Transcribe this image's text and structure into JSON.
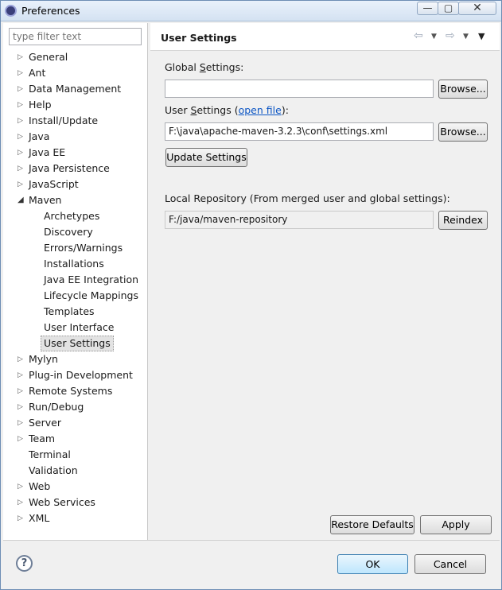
{
  "window": {
    "title": "Preferences",
    "min_glyph": "—",
    "max_glyph": "▢",
    "close_glyph": "✕"
  },
  "sidebar": {
    "filter_placeholder": "type filter text",
    "items": [
      {
        "label": "General",
        "expandable": true,
        "expanded": false,
        "level": 0
      },
      {
        "label": "Ant",
        "expandable": true,
        "expanded": false,
        "level": 0
      },
      {
        "label": "Data Management",
        "expandable": true,
        "expanded": false,
        "level": 0
      },
      {
        "label": "Help",
        "expandable": true,
        "expanded": false,
        "level": 0
      },
      {
        "label": "Install/Update",
        "expandable": true,
        "expanded": false,
        "level": 0
      },
      {
        "label": "Java",
        "expandable": true,
        "expanded": false,
        "level": 0
      },
      {
        "label": "Java EE",
        "expandable": true,
        "expanded": false,
        "level": 0
      },
      {
        "label": "Java Persistence",
        "expandable": true,
        "expanded": false,
        "level": 0
      },
      {
        "label": "JavaScript",
        "expandable": true,
        "expanded": false,
        "level": 0
      },
      {
        "label": "Maven",
        "expandable": true,
        "expanded": true,
        "level": 0
      },
      {
        "label": "Archetypes",
        "expandable": false,
        "level": 1
      },
      {
        "label": "Discovery",
        "expandable": false,
        "level": 1
      },
      {
        "label": "Errors/Warnings",
        "expandable": false,
        "level": 1
      },
      {
        "label": "Installations",
        "expandable": false,
        "level": 1
      },
      {
        "label": "Java EE Integration",
        "expandable": false,
        "level": 1
      },
      {
        "label": "Lifecycle Mappings",
        "expandable": false,
        "level": 1
      },
      {
        "label": "Templates",
        "expandable": false,
        "level": 1
      },
      {
        "label": "User Interface",
        "expandable": false,
        "level": 1
      },
      {
        "label": "User Settings",
        "expandable": false,
        "level": 1,
        "selected": true
      },
      {
        "label": "Mylyn",
        "expandable": true,
        "expanded": false,
        "level": 0
      },
      {
        "label": "Plug-in Development",
        "expandable": true,
        "expanded": false,
        "level": 0
      },
      {
        "label": "Remote Systems",
        "expandable": true,
        "expanded": false,
        "level": 0
      },
      {
        "label": "Run/Debug",
        "expandable": true,
        "expanded": false,
        "level": 0
      },
      {
        "label": "Server",
        "expandable": true,
        "expanded": false,
        "level": 0
      },
      {
        "label": "Team",
        "expandable": true,
        "expanded": false,
        "level": 0
      },
      {
        "label": "Terminal",
        "expandable": false,
        "level": 0
      },
      {
        "label": "Validation",
        "expandable": false,
        "level": 0
      },
      {
        "label": "Web",
        "expandable": true,
        "expanded": false,
        "level": 0
      },
      {
        "label": "Web Services",
        "expandable": true,
        "expanded": false,
        "level": 0
      },
      {
        "label": "XML",
        "expandable": true,
        "expanded": false,
        "level": 0
      }
    ]
  },
  "page": {
    "title": "User Settings",
    "nav": {
      "back_glyph": "⇦",
      "forward_glyph": "⇨",
      "dropdown_glyph": "▼",
      "view_menu_glyph": "▼"
    },
    "global_settings": {
      "label_before": "Global ",
      "label_mnemonic": "S",
      "label_after": "ettings:",
      "value": "",
      "browse_label": "Browse..."
    },
    "user_settings": {
      "label_before": "User ",
      "label_mnemonic": "S",
      "label_after": "ettings (",
      "link_label": "open file",
      "label_close": "):",
      "value": "F:\\java\\apache-maven-3.2.3\\conf\\settings.xml",
      "browse_label": "Browse..."
    },
    "update_settings_label": "Update Settings",
    "local_repository": {
      "label": "Local Repository (From merged user and global settings):",
      "value": "F:/java/maven-repository",
      "reindex_label": "Reindex"
    },
    "restore_defaults_label": "Restore Defaults",
    "apply_label": "Apply"
  },
  "footer": {
    "help_glyph": "?",
    "ok_label": "OK",
    "cancel_label": "Cancel"
  }
}
